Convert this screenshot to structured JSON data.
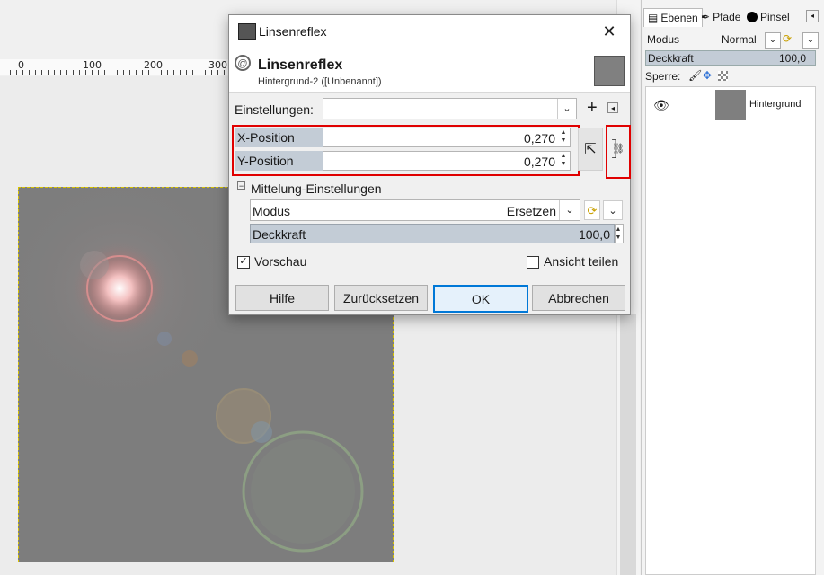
{
  "ruler": {
    "labels": [
      "0",
      "100",
      "200",
      "300"
    ]
  },
  "dock": {
    "tabs": [
      "Ebenen",
      "Pfade",
      "Pinsel"
    ],
    "modus_label": "Modus",
    "modus_value": "Normal",
    "deckkraft_label": "Deckkraft",
    "deckkraft_value": "100,0",
    "sperre_label": "Sperre:",
    "layer_name": "Hintergrund"
  },
  "dialog": {
    "window_title": "Linsenreflex",
    "header_title": "Linsenreflex",
    "header_subtitle": "Hintergrund-2 ([Unbenannt])",
    "einstellungen_label": "Einstellungen:",
    "einstellungen_value": "",
    "x_label": "X-Position",
    "x_value": "0,270",
    "y_label": "Y-Position",
    "y_value": "0,270",
    "blend_section_label": "Mittelung-Einstellungen",
    "modus_label": "Modus",
    "modus_value": "Ersetzen",
    "deckkraft_label": "Deckkraft",
    "deckkraft_value": "100,0",
    "preview_label": "Vorschau",
    "preview_checked": true,
    "split_label": "Ansicht teilen",
    "split_checked": false,
    "buttons": {
      "help": "Hilfe",
      "reset": "Zurücksetzen",
      "ok": "OK",
      "cancel": "Abbrechen"
    }
  },
  "colors": {
    "highlight": "#e00000",
    "accent": "#0078d7",
    "slider": "#c3ccd6"
  }
}
